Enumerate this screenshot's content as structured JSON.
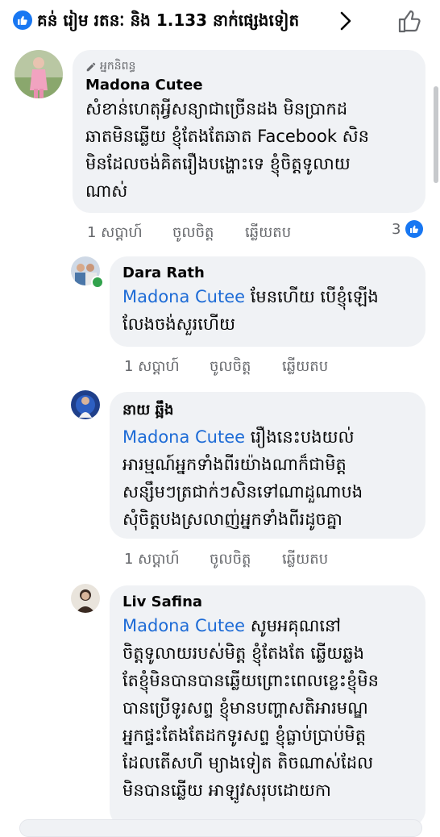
{
  "reactions_bar": {
    "summary": "គន់ រៀម រតនៈ និង 1.133 នាក់ផ្សេងទៀត",
    "icons": [
      "like-icon",
      "chevron-right-icon",
      "thumbs-up-outline-icon"
    ]
  },
  "colors": {
    "accent": "#1877f2",
    "mention": "#1d6bd6",
    "bubble": "#f0f2f5",
    "meta_text": "#65676b",
    "online": "#31a24c"
  },
  "comments": [
    {
      "author_tag": "អ្នកនិពន្ធ",
      "author": "Madona Cutee",
      "lines": [
        "សំខាន់ហេតុអ្វីសន្យាជាច្រើនដង មិនប្រាកដ",
        "ឆាតមិនឆ្លើយ ខ្ញុំតែងតែឆាត Facebook សិន",
        "មិនដែលចង់គិតរឿងបង្ហោះទេ ខ្ញុំចិត្តទូលាយ",
        "ណាស់"
      ],
      "time": "1 សប្តាហ៍",
      "like_label": "ចូលចិត្ត",
      "reply_label": "ឆ្លើយតប",
      "reaction_count": "3"
    },
    {
      "author": "Dara Rath",
      "mention": "Madona Cutee",
      "line1_rest": " មែនហើយ បើខ្ញុំឡើង",
      "lines_after": [
        "លែងចង់សួរហើយ"
      ],
      "time": "1 សប្តាហ៍",
      "like_label": "ចូលចិត្ត",
      "reply_label": "ឆ្លើយតប"
    },
    {
      "author": "នាយ ឆ្អឹង",
      "mention": "Madona Cutee",
      "line1_rest": " រឿងនេះបងយល់",
      "lines_after": [
        "អារម្មណ៍អ្នកទាំងពីរយ៉ាងណាក៏ជាមិត្ត",
        "សន្សឹមៗត្រជាក់ៗសិនទៅណាដួណាបង",
        "សុំចិត្តបងស្រលាញ់អ្នកទាំងពីរដូចគ្នា"
      ],
      "time": "1 សប្តាហ៍",
      "like_label": "ចូលចិត្ត",
      "reply_label": "ឆ្លើយតប"
    },
    {
      "author": "Liv Safina",
      "mention": "Madona Cutee",
      "line1_rest": " សូមអគុណនៅ",
      "lines_after": [
        "ចិត្តទូលាយរបស់មិត្ត ខ្ញុំតែងតែ ឆ្លើយឆ្លង",
        "តែខ្ញុំមិនបានបានឆ្លើយព្រោះពេលខ្លេះខ្ញុំមិន",
        "បានប្រើទូរសព្ទ ខ្ញុំមានបញ្ហាសតិអារមណ្ឌ",
        "អ្នកផ្ទះតែងតែដកទូរសព្ទ ខ្ញុំធ្លាប់ប្រាប់មិត្ត",
        "ដែលតើសហី ម្យាងទៀត តិចណាស់ដែល",
        "មិនបានឆ្លើយ អាឡូវសរុបដោយកា"
      ]
    }
  ]
}
